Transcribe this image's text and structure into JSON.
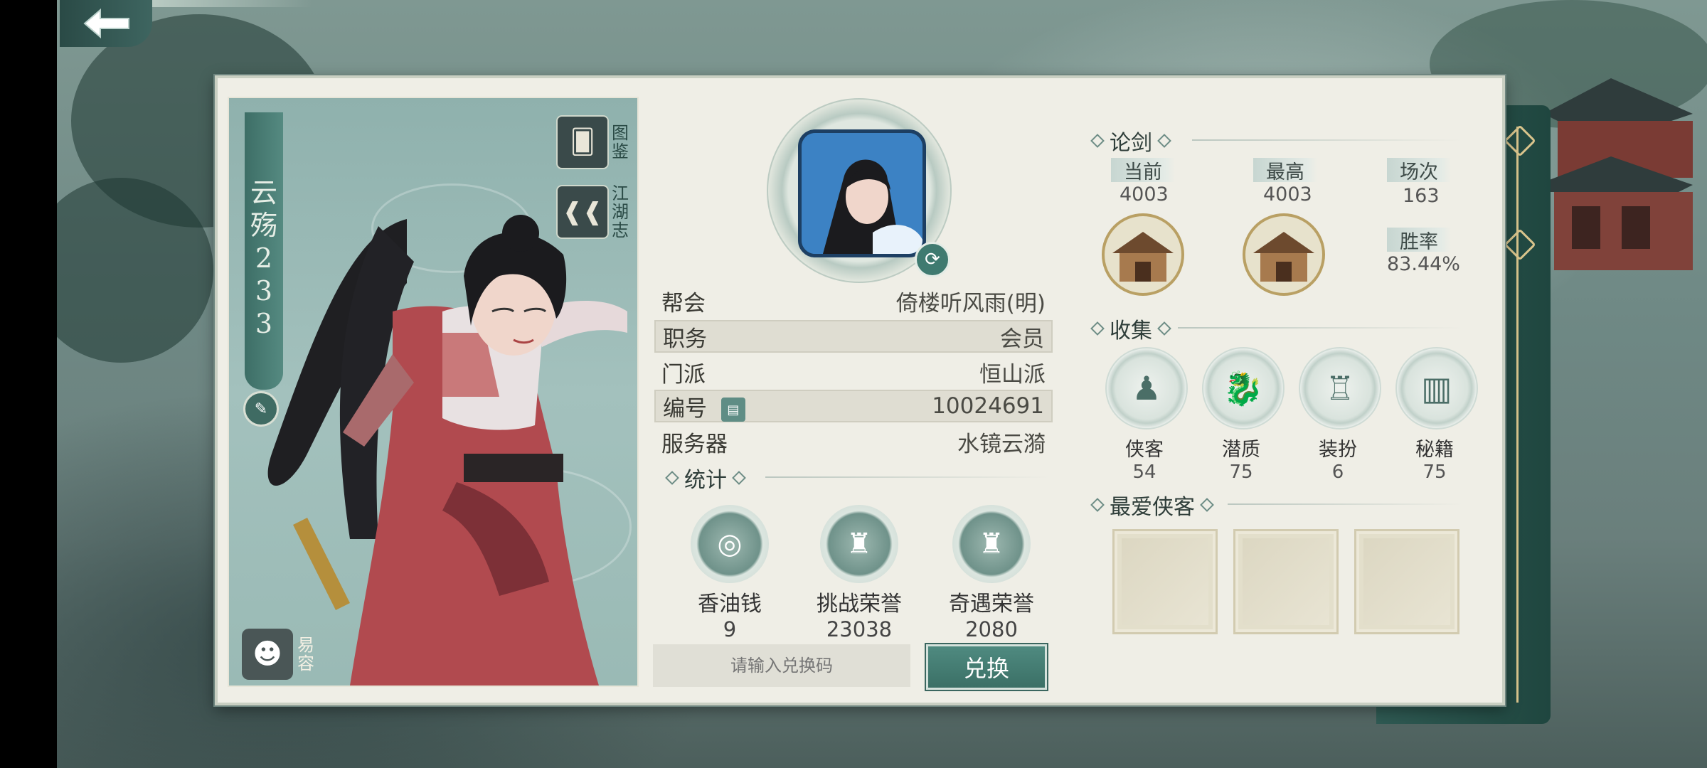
{
  "character": {
    "name_chars": [
      "云",
      "殇",
      "2",
      "3",
      "3"
    ],
    "atlas_label": [
      "图",
      "鉴"
    ],
    "jianghu_label": [
      "江",
      "湖",
      "志"
    ],
    "disguise_label": [
      "易",
      "容"
    ]
  },
  "profile": {
    "rows": [
      {
        "label": "帮会",
        "value": "倚楼听风雨(明)"
      },
      {
        "label": "职务",
        "value": "会员"
      },
      {
        "label": "门派",
        "value": "恒山派"
      },
      {
        "label": "编号",
        "value": "10024691"
      },
      {
        "label": "服务器",
        "value": "水镜云漪"
      }
    ]
  },
  "stats": {
    "title": "统计",
    "items": [
      {
        "name": "香油钱",
        "value": "9"
      },
      {
        "name": "挑战荣誉",
        "value": "23038"
      },
      {
        "name": "奇遇荣誉",
        "value": "2080"
      }
    ]
  },
  "redeem": {
    "placeholder": "请输入兑换码",
    "button": "兑换"
  },
  "duel": {
    "title": "论剑",
    "current_label": "当前",
    "current_value": "4003",
    "best_label": "最高",
    "best_value": "4003",
    "matches_label": "场次",
    "matches_value": "163",
    "winrate_label": "胜率",
    "winrate_value": "83.44%"
  },
  "collection": {
    "title": "收集",
    "items": [
      {
        "name": "侠客",
        "value": "54"
      },
      {
        "name": "潜质",
        "value": "75"
      },
      {
        "name": "装扮",
        "value": "6"
      },
      {
        "name": "秘籍",
        "value": "75"
      }
    ]
  },
  "favorites": {
    "title": "最爱侠客"
  },
  "colors": {
    "accent": "#3b7066",
    "panel": "#efeee6"
  }
}
